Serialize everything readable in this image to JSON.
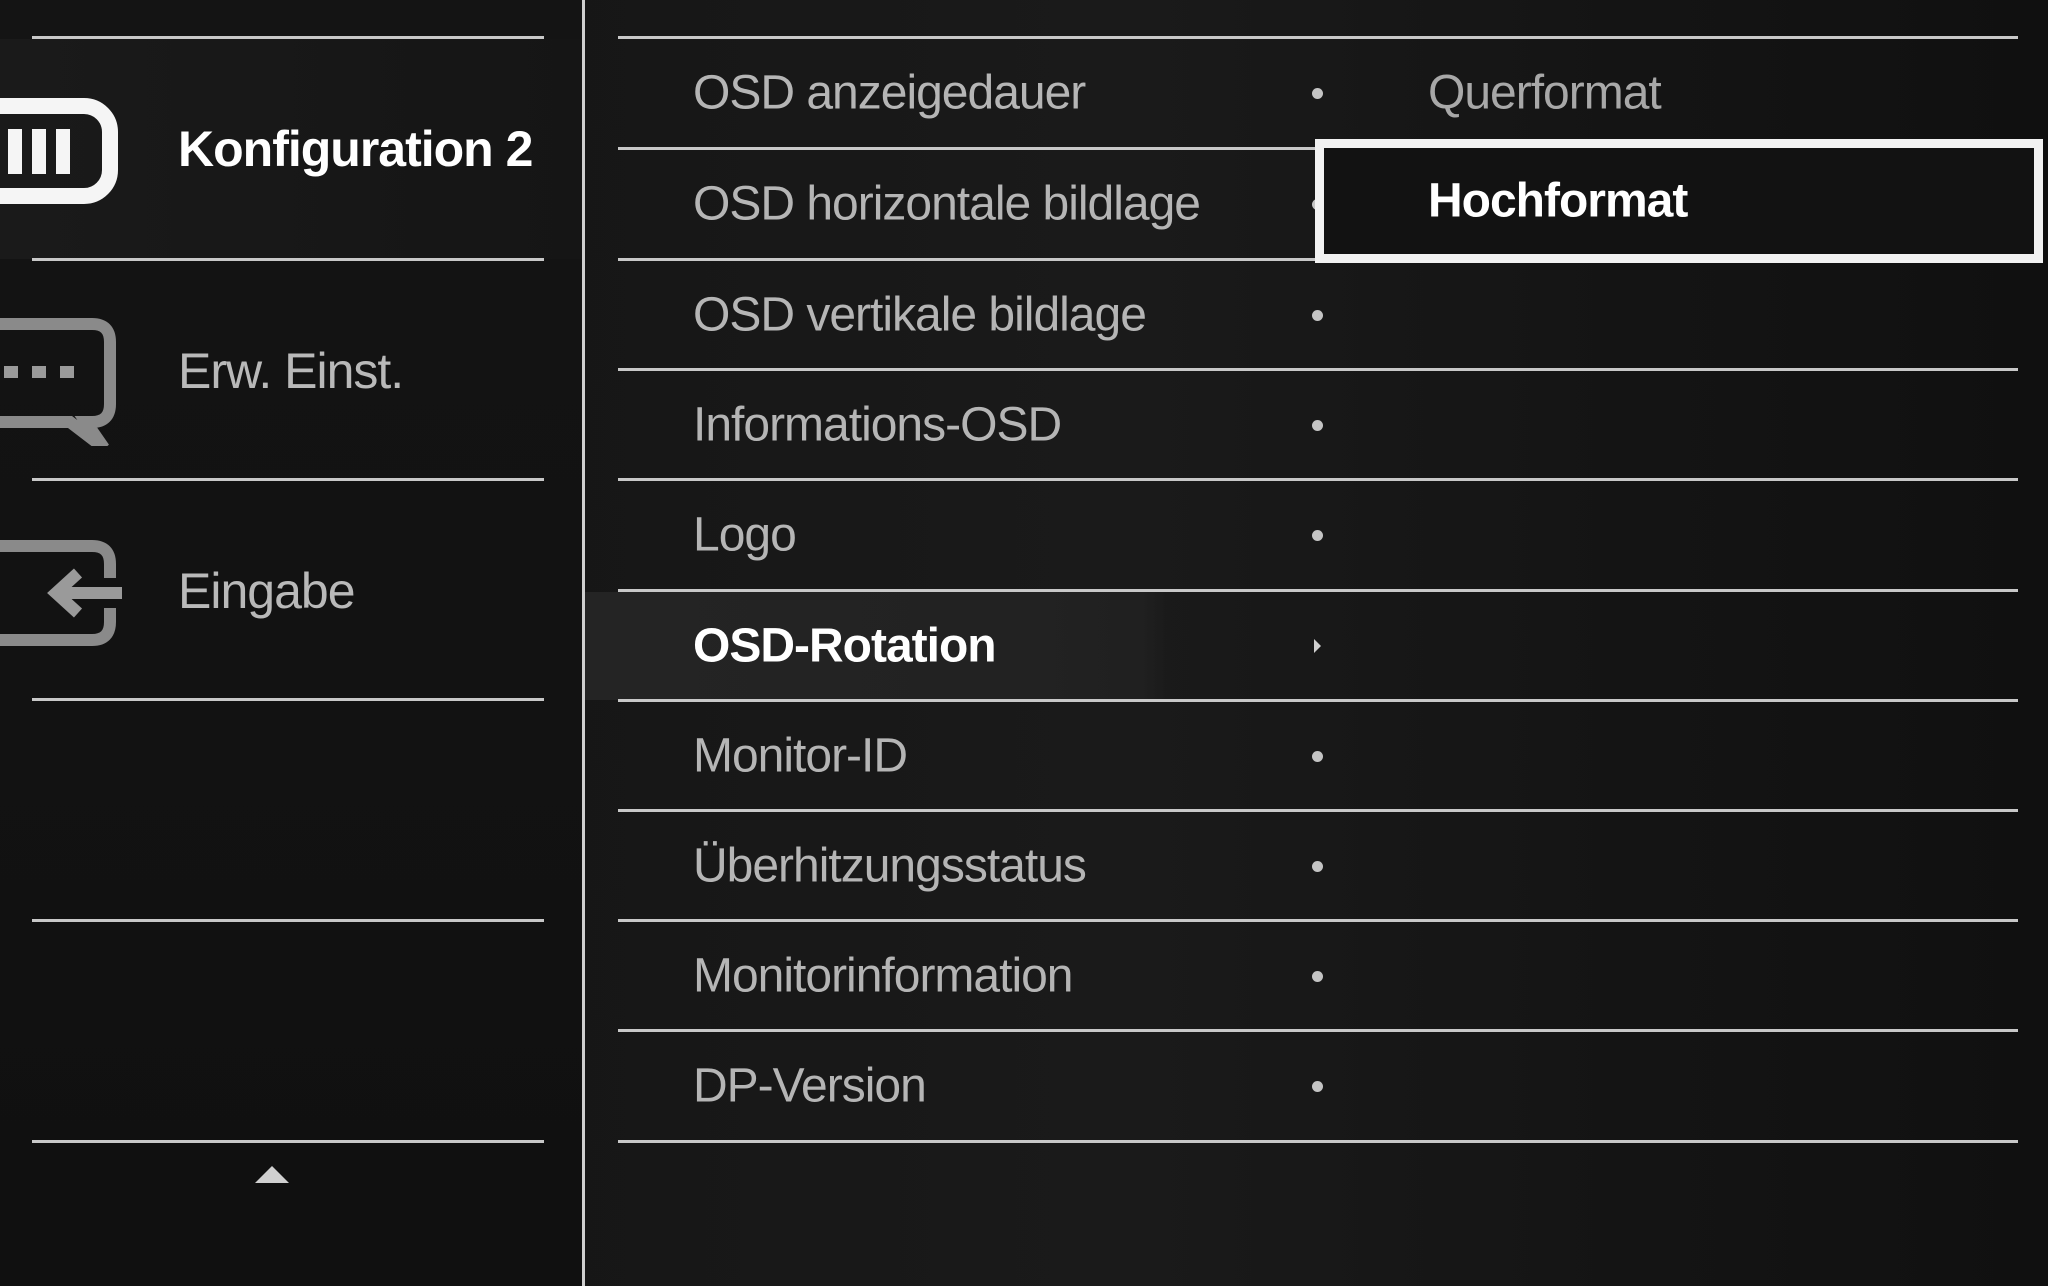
{
  "left_menu": {
    "items": [
      {
        "label": "Konfiguration 2",
        "icon": "setup-icon",
        "active": true
      },
      {
        "label": "Erw. Einst.",
        "icon": "speech-bubble-icon",
        "active": false
      },
      {
        "label": "Eingabe",
        "icon": "input-icon",
        "active": false
      }
    ],
    "scroll_icon": "triangle-up-icon"
  },
  "submenu": {
    "items": [
      {
        "label": "OSD anzeigedauer"
      },
      {
        "label": "OSD horizontale bildlage"
      },
      {
        "label": "OSD vertikale bildlage"
      },
      {
        "label": "Informations-OSD"
      },
      {
        "label": "Logo"
      },
      {
        "label": "OSD-Rotation",
        "selected": true
      },
      {
        "label": "Monitor-ID"
      },
      {
        "label": "Überhitzungsstatus"
      },
      {
        "label": "Monitorinformation"
      },
      {
        "label": "DP-Version"
      }
    ]
  },
  "options": {
    "items": [
      {
        "label": "Querformat",
        "highlighted": false
      },
      {
        "label": "Hochformat",
        "highlighted": true
      }
    ]
  },
  "colors": {
    "background": "#141414",
    "text_normal": "#b5b5b5",
    "text_active": "#ffffff",
    "divider": "#c8c8c8",
    "highlight_border": "#f2f2f2"
  }
}
